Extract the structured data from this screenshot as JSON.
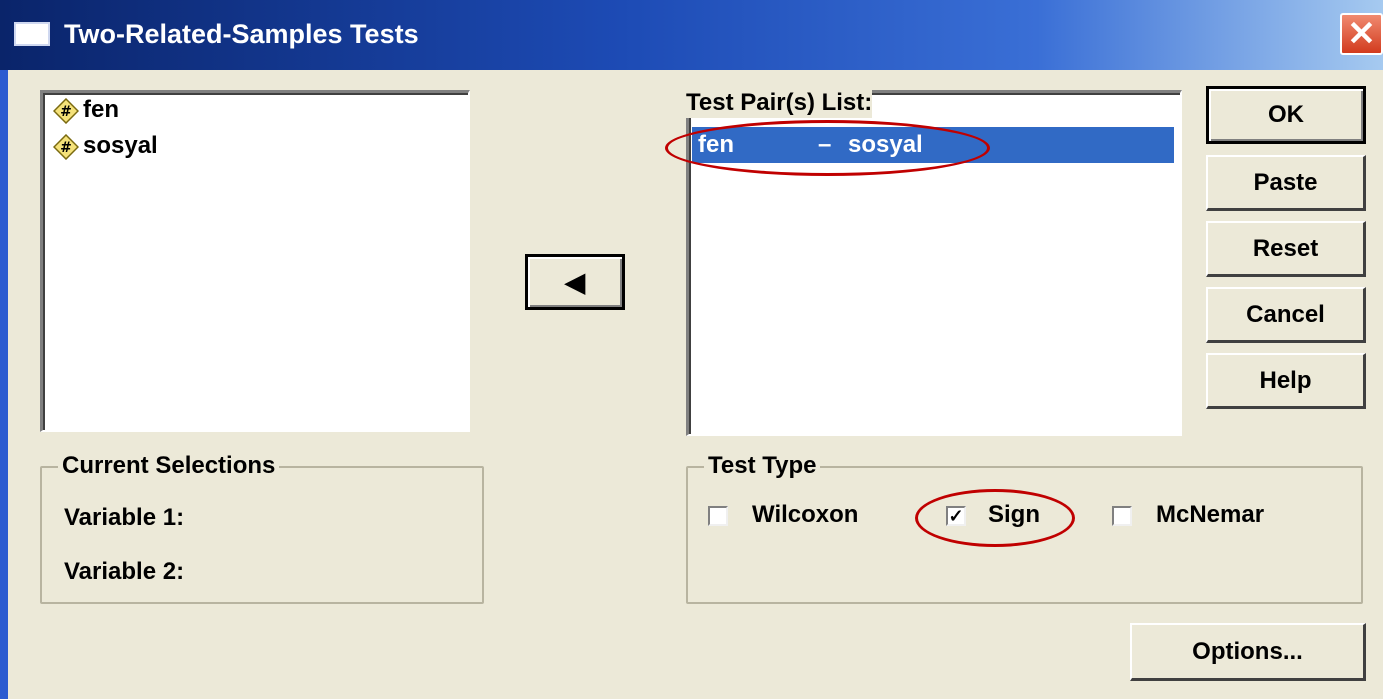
{
  "window": {
    "title": "Two-Related-Samples Tests",
    "close_label": "✕"
  },
  "variables": [
    {
      "name": "fen",
      "icon": "numeric-variable-icon"
    },
    {
      "name": "sosyal",
      "icon": "numeric-variable-icon"
    }
  ],
  "move_button": {
    "label": "◀",
    "icon": "left-arrow-icon"
  },
  "test_pairs": {
    "label": "Test Pair(s) List:",
    "rows": [
      {
        "var1": "fen",
        "separator": "–",
        "var2": "sosyal"
      }
    ]
  },
  "buttons": {
    "ok": "OK",
    "paste": "Paste",
    "reset": "Reset",
    "cancel": "Cancel",
    "help": "Help",
    "options": "Options..."
  },
  "current_selections": {
    "title": "Current Selections",
    "variable1": "Variable 1:",
    "variable2": "Variable 2:"
  },
  "test_type": {
    "title": "Test Type",
    "options": [
      {
        "label": "Wilcoxon",
        "checked": false
      },
      {
        "label": "Sign",
        "checked": true
      },
      {
        "label": "McNemar",
        "checked": false
      }
    ]
  },
  "colors": {
    "accent": "#316ac5",
    "annotation": "#c00000",
    "face": "#ece9d8"
  }
}
